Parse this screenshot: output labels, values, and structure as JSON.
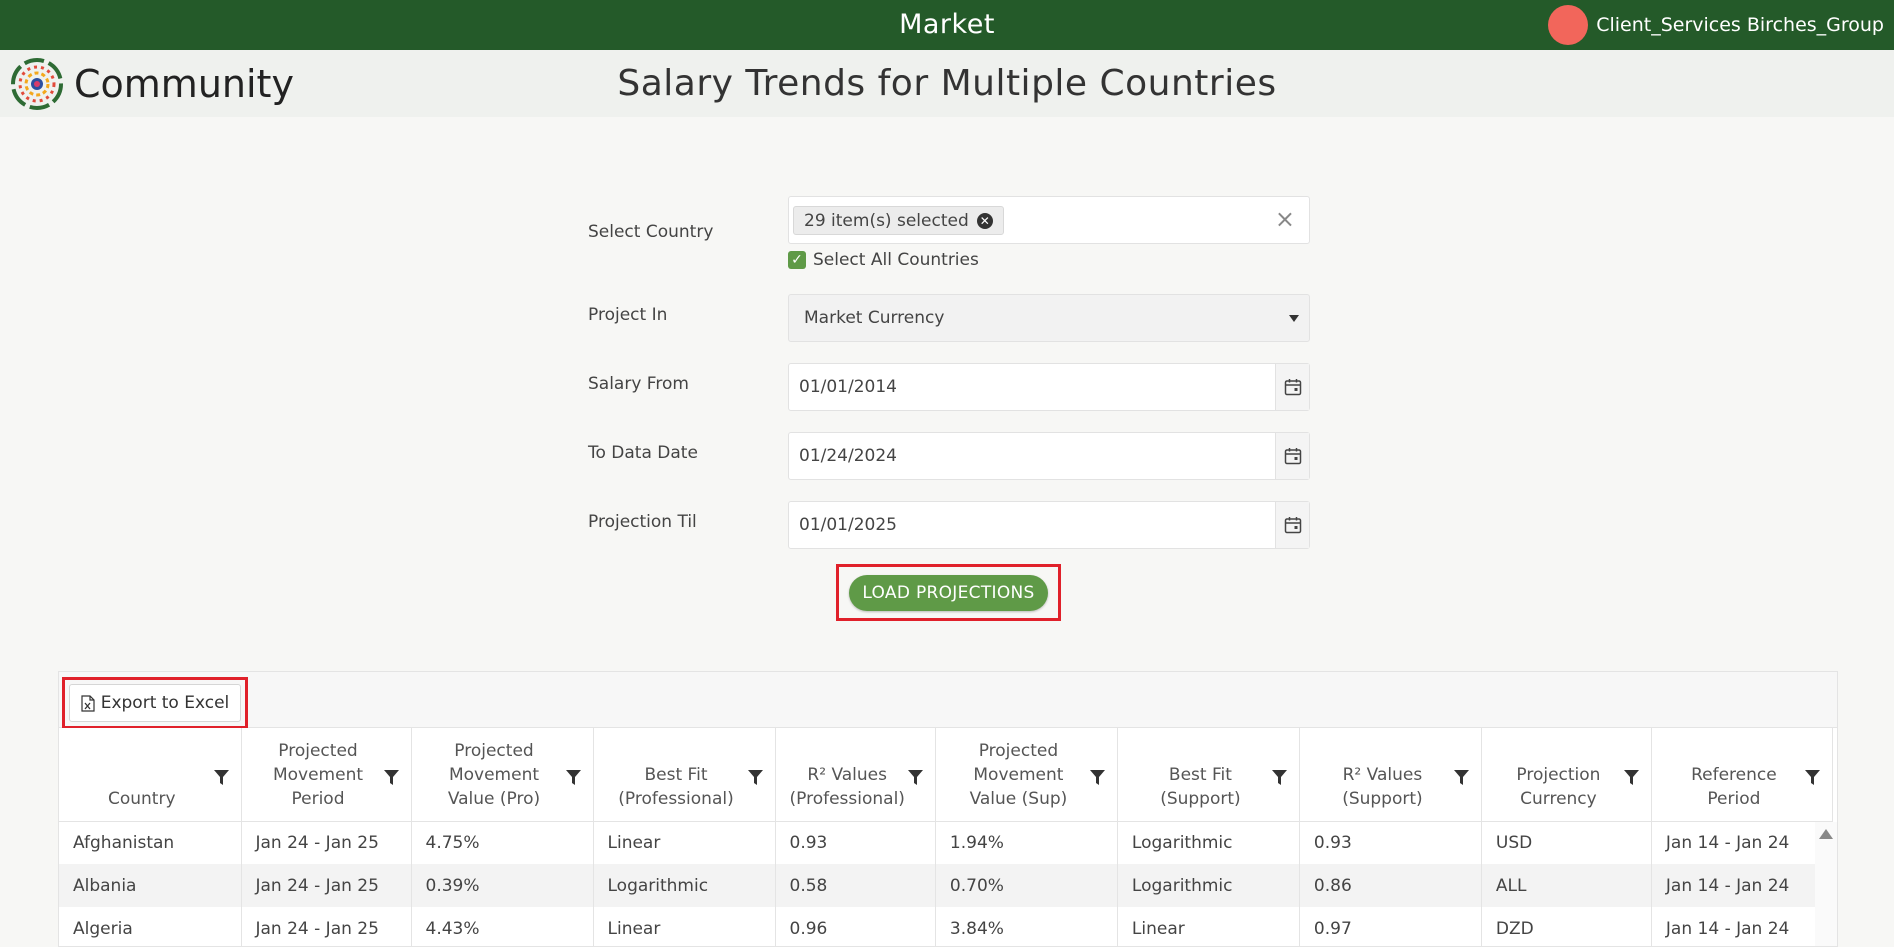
{
  "header": {
    "app_title": "Market",
    "user_name": "Client_Services Birches_Group"
  },
  "subheader": {
    "logo_text": "Community",
    "page_title": "Salary Trends for Multiple Countries"
  },
  "form": {
    "country": {
      "label": "Select Country",
      "chip_text": "29 item(s) selected",
      "select_all_label": "Select All Countries",
      "select_all_checked": true
    },
    "project_in": {
      "label": "Project In",
      "value": "Market Currency"
    },
    "salary_from": {
      "label": "Salary From",
      "value": "01/01/2014"
    },
    "to_data_date": {
      "label": "To Data Date",
      "value": "01/24/2024"
    },
    "projection_til": {
      "label": "Projection Til",
      "value": "01/01/2025"
    },
    "load_button": "LOAD PROJECTIONS"
  },
  "grid": {
    "export_label": "Export to Excel",
    "columns": [
      "Country",
      "Projected Movement Period",
      "Projected Movement Value (Pro)",
      "Best Fit (Professional)",
      "R² Values (Professional)",
      "Projected Movement Value (Sup)",
      "Best Fit (Support)",
      "R² Values (Support)",
      "Projection Currency",
      "Reference Period"
    ],
    "rows": [
      [
        "Afghanistan",
        "Jan 24 - Jan 25",
        "4.75%",
        "Linear",
        "0.93",
        "1.94%",
        "Logarithmic",
        "0.93",
        "USD",
        "Jan 14 - Jan 24"
      ],
      [
        "Albania",
        "Jan 24 - Jan 25",
        "0.39%",
        "Logarithmic",
        "0.58",
        "0.70%",
        "Logarithmic",
        "0.86",
        "ALL",
        "Jan 14 - Jan 24"
      ],
      [
        "Algeria",
        "Jan 24 - Jan 25",
        "4.43%",
        "Linear",
        "0.96",
        "3.84%",
        "Linear",
        "0.97",
        "DZD",
        "Jan 14 - Jan 24"
      ]
    ]
  },
  "colors": {
    "header_green": "#245a29",
    "button_green": "#5f9a47",
    "highlight_red": "#e0202a",
    "avatar": "#f2665b"
  }
}
